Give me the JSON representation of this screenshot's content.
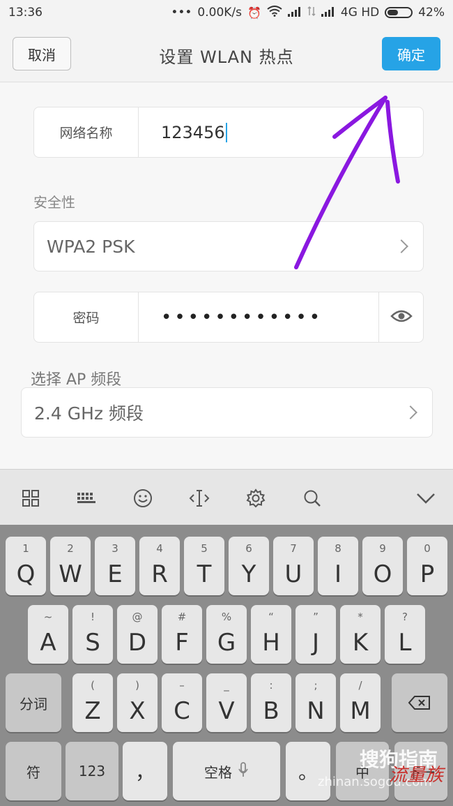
{
  "status_bar": {
    "time": "13:36",
    "dots": "•••",
    "speed": "0.00K/s",
    "network": "4G HD",
    "battery": "42%"
  },
  "header": {
    "cancel_label": "取消",
    "title": "设置 WLAN 热点",
    "confirm_label": "确定"
  },
  "form": {
    "network_name_label": "网络名称",
    "network_name_value": "123456",
    "security_section": "安全性",
    "security_value": "WPA2 PSK",
    "password_label": "密码",
    "password_value": "••••••••••••",
    "band_section": "选择 AP 频段",
    "band_value": "2.4 GHz 频段"
  },
  "keyboard": {
    "toolbar_icons": [
      "grid-icon",
      "keyboard-icon",
      "emoji-icon",
      "cursor-icon",
      "settings-icon",
      "search-icon",
      "collapse-icon"
    ],
    "row1": [
      {
        "sub": "1",
        "main": "Q"
      },
      {
        "sub": "2",
        "main": "W"
      },
      {
        "sub": "3",
        "main": "E"
      },
      {
        "sub": "4",
        "main": "R"
      },
      {
        "sub": "5",
        "main": "T"
      },
      {
        "sub": "6",
        "main": "Y"
      },
      {
        "sub": "7",
        "main": "U"
      },
      {
        "sub": "8",
        "main": "I"
      },
      {
        "sub": "9",
        "main": "O"
      },
      {
        "sub": "0",
        "main": "P"
      }
    ],
    "row2": [
      {
        "sub": "~",
        "main": "A"
      },
      {
        "sub": "!",
        "main": "S"
      },
      {
        "sub": "@",
        "main": "D"
      },
      {
        "sub": "#",
        "main": "F"
      },
      {
        "sub": "%",
        "main": "G"
      },
      {
        "sub": "“",
        "main": "H"
      },
      {
        "sub": "”",
        "main": "J"
      },
      {
        "sub": "*",
        "main": "K"
      },
      {
        "sub": "?",
        "main": "L"
      }
    ],
    "row3": [
      {
        "sub": "(",
        "main": "Z"
      },
      {
        "sub": ")",
        "main": "X"
      },
      {
        "sub": "–",
        "main": "C"
      },
      {
        "sub": "_",
        "main": "V"
      },
      {
        "sub": ":",
        "main": "B"
      },
      {
        "sub": ";",
        "main": "N"
      },
      {
        "sub": "/",
        "main": "M"
      }
    ],
    "segment_label": "分词",
    "symbol_label": "符",
    "num_label": "123",
    "comma_label": "，",
    "space_label": "空格",
    "period_label": "。",
    "lang_label": "中",
    "next_label": "下一"
  },
  "watermark": {
    "brand": "搜狗指南",
    "url": "zhinan.sogou.com",
    "stamp": "流量族"
  },
  "colors": {
    "accent": "#26a3e6",
    "arrow": "#8a18e0"
  }
}
